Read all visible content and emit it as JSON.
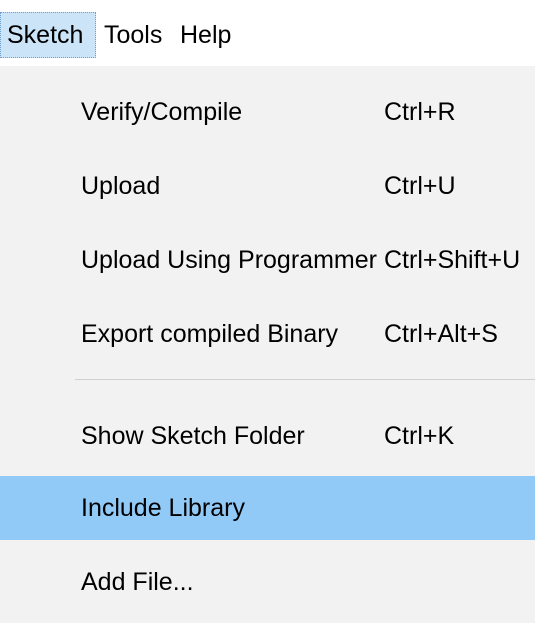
{
  "menubar": {
    "items": [
      {
        "label": "Sketch",
        "active": true
      },
      {
        "label": "Tools",
        "active": false
      },
      {
        "label": "Help",
        "active": false
      }
    ]
  },
  "menu": {
    "items": [
      {
        "label": "Verify/Compile",
        "shortcut": "Ctrl+R"
      },
      {
        "label": "Upload",
        "shortcut": "Ctrl+U"
      },
      {
        "label": "Upload Using Programmer",
        "shortcut": "Ctrl+Shift+U"
      },
      {
        "label": "Export compiled Binary",
        "shortcut": "Ctrl+Alt+S"
      },
      {
        "label": "Show Sketch Folder",
        "shortcut": "Ctrl+K"
      },
      {
        "label": "Include Library",
        "shortcut": "",
        "highlighted": true
      },
      {
        "label": "Add File...",
        "shortcut": ""
      }
    ]
  },
  "colors": {
    "menu_background": "#f2f2f2",
    "highlight": "#91c9f7",
    "menubar_active": "#cce4f7"
  }
}
